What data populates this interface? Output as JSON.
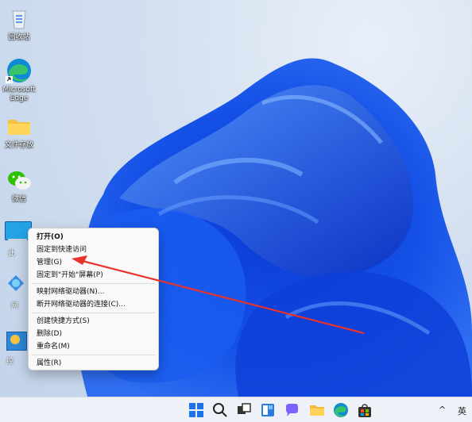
{
  "desktop": {
    "icons": [
      {
        "label": "回收站",
        "icon": "recycle-bin-icon"
      },
      {
        "label": "Microsoft Edge",
        "icon": "edge-icon"
      },
      {
        "label": "文件存放",
        "icon": "folder-icon"
      },
      {
        "label": "微信",
        "icon": "wechat-icon"
      }
    ],
    "partial_labels": [
      "此",
      "网",
      "控"
    ]
  },
  "context_menu": {
    "items": [
      {
        "label": "打开(O)",
        "bold": true
      },
      {
        "label": "固定到快速访问"
      },
      {
        "label": "管理(G)"
      },
      {
        "label": "固定到\"开始\"屏幕(P)"
      },
      {
        "label": "映射网络驱动器(N)..."
      },
      {
        "label": "断开网络驱动器的连接(C)..."
      },
      {
        "label": "创建快捷方式(S)"
      },
      {
        "label": "删除(D)"
      },
      {
        "label": "重命名(M)"
      },
      {
        "label": "属性(R)"
      }
    ]
  },
  "taskbar": {
    "apps": [
      "start-icon",
      "search-icon",
      "task-view-icon",
      "widgets-icon",
      "chat-icon",
      "file-explorer-icon",
      "edge-icon",
      "store-icon"
    ],
    "tray": {
      "chevron": "^",
      "ime": "英"
    }
  },
  "annotation": {
    "color": "#e8322c"
  }
}
